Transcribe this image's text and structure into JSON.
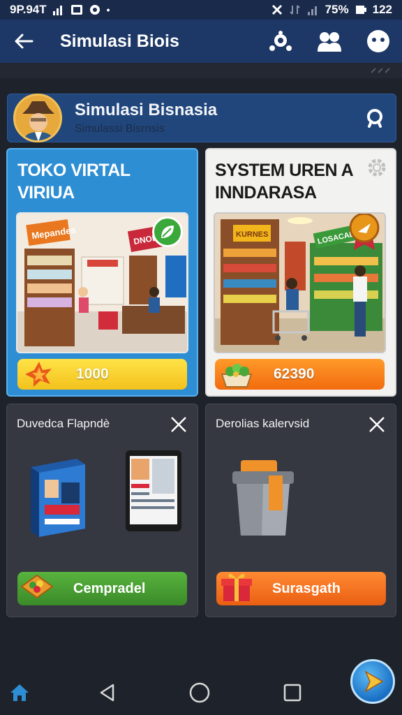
{
  "status_bar": {
    "time": "9P.94T",
    "battery": "75%",
    "clock": "122"
  },
  "app_bar": {
    "title": "Simulasi Biois"
  },
  "header": {
    "title": "Simulasi Bisnasia",
    "subtitle": "Simulassi Bisrnsis"
  },
  "cards": [
    {
      "title": "TOKO VIRTAL\nVIRIUA",
      "sign_1": "Mepandes",
      "sign_2": "DNOD BK",
      "price": "1000"
    },
    {
      "title": "SYSTEM UREN A\nINNDARASA",
      "sign_1": "KURNES",
      "sign_2": "LOSACAL",
      "price": "62390"
    }
  ],
  "panels": [
    {
      "title": "Duvedca Flapndè",
      "button": "Cempradel"
    },
    {
      "title": "Derolias kalervsid",
      "button": "Surasgath"
    }
  ],
  "colors": {
    "app_bar": "#1d3766",
    "accent_blue": "#2d8ed3",
    "green": "#3a8a28",
    "orange": "#ea5f12"
  }
}
